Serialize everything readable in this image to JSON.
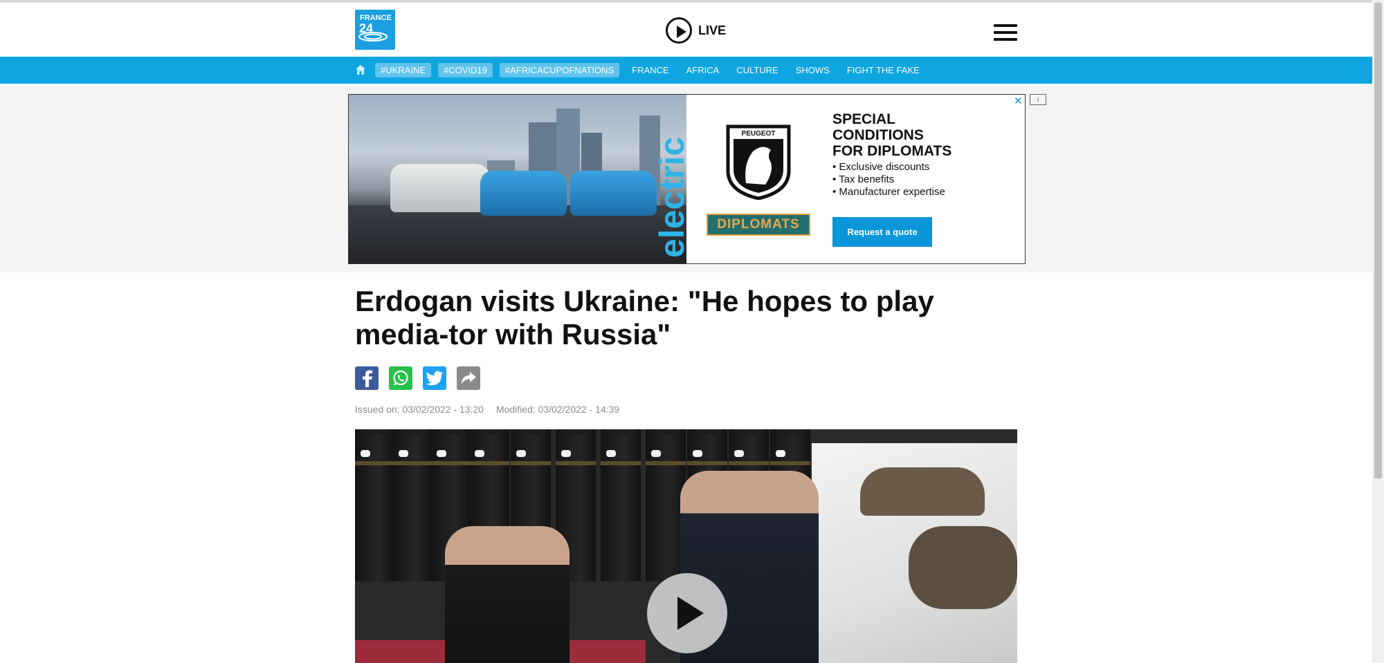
{
  "header": {
    "logo_line1": "FRANCE",
    "logo_line2": "24",
    "live_label": "LIVE"
  },
  "nav": {
    "tags": [
      "#UKRAINE",
      "#COVID19",
      "#AFRICACUPOFNATIONS"
    ],
    "links": [
      "FRANCE",
      "AFRICA",
      "CULTURE",
      "SHOWS",
      "FIGHT THE FAKE"
    ]
  },
  "ad": {
    "electric_word": "electric",
    "brand": "PEUGEOT",
    "badge": "DIPLOMATS",
    "headline_lines": [
      "SPECIAL",
      "CONDITIONS",
      "FOR DIPLOMATS"
    ],
    "bullets": [
      "• Exclusive discounts",
      "• Tax benefits",
      "• Manufacturer expertise"
    ],
    "cta": "Request a quote",
    "close_glyph": "✕"
  },
  "article": {
    "title": "Erdogan visits Ukraine: \"He hopes to play media-tor with Russia\"",
    "issued": "Issued on: 03/02/2022 - 13:20",
    "modified": "Modified: 03/02/2022 - 14:39"
  },
  "share": [
    "facebook-icon",
    "whatsapp-icon",
    "twitter-icon",
    "share-icon"
  ],
  "colors": {
    "brand_blue": "#0ea5e0",
    "tag_bg": "#5fc3ec",
    "cta_blue": "#0a96d8",
    "facebook": "#3b5a9a",
    "whatsapp": "#25c24a",
    "twitter": "#1da1f2",
    "share": "#8a8a8a"
  }
}
